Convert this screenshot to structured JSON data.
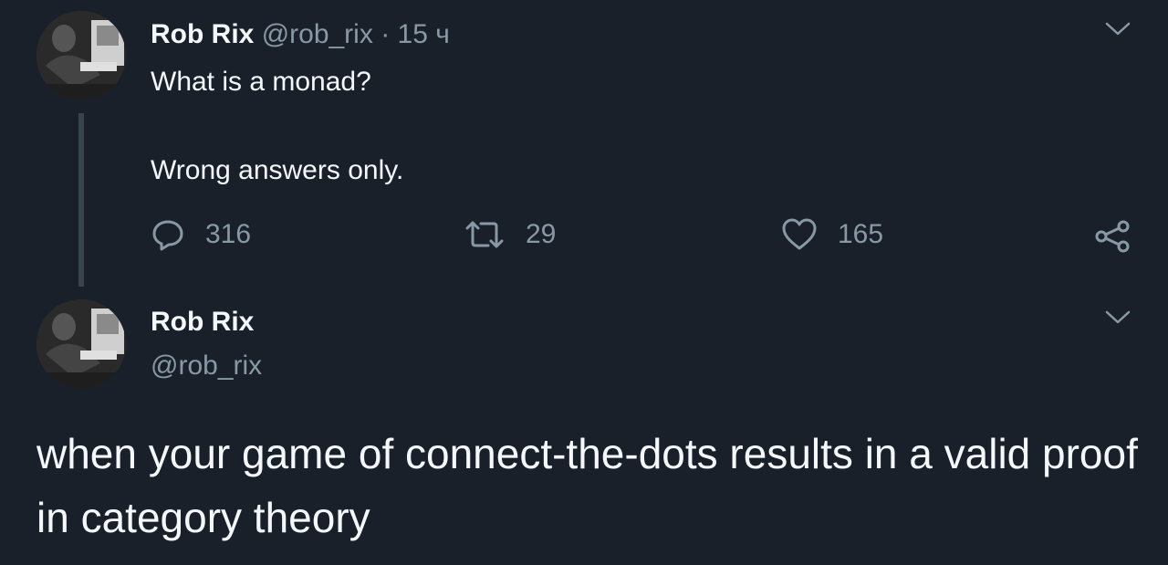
{
  "original_tweet": {
    "author_name": "Rob Rix",
    "handle": "@rob_rix",
    "separator": "·",
    "time": "15 ч",
    "text_line_1": "What is a monad?",
    "text_line_2": "Wrong answers only.",
    "actions": {
      "reply_count": "316",
      "retweet_count": "29",
      "like_count": "165"
    },
    "avatar_icon": "profile-photo",
    "menu_icon": "chevron-down-icon"
  },
  "reply_tweet": {
    "author_name": "Rob Rix",
    "handle": "@rob_rix",
    "text": "when your game of connect-the-dots results in a valid proof in category theory",
    "avatar_icon": "profile-photo",
    "menu_icon": "chevron-down-icon"
  },
  "colors": {
    "background": "#1a202a",
    "primary_text": "#f5f8fa",
    "secondary_text": "#8899a6",
    "thread_line": "#38444d"
  }
}
